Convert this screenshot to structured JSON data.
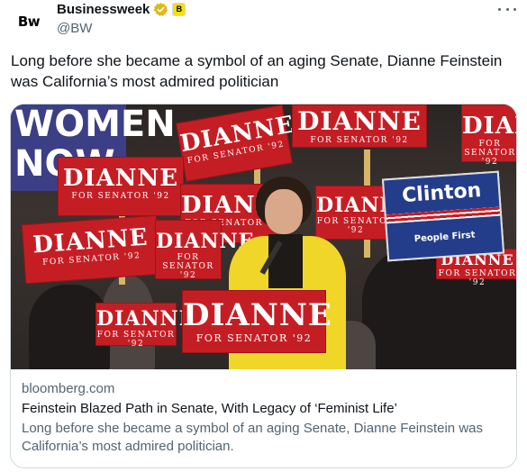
{
  "author": {
    "avatar_text": "Bw",
    "display_name": "Businessweek",
    "handle": "@BW",
    "affiliate_badge_text": "B"
  },
  "tweet": {
    "text": "Long before she became a symbol of an aging Senate, Dianne Feinstein was California’s most admired politician"
  },
  "card": {
    "domain": "bloomberg.com",
    "title": "Feinstein Blazed Path in Senate, With Legacy of ‘Feminist Life’",
    "description": "Long before she became a symbol of an aging Senate, Dianne Feinstein was California’s most admired politician.",
    "image": {
      "sign_main": "DIANNE",
      "sign_sub": "FOR SENATOR '92",
      "women_sign_line1": "WOMEN",
      "women_sign_line2": "NOW",
      "clinton_name": "Clinton",
      "clinton_slogan": "People First"
    }
  },
  "colors": {
    "sign_red": "#c41e24",
    "text_primary": "#0f1419",
    "text_secondary": "#536471",
    "verified_gold": "#e2b719",
    "card_border": "#cfd9de"
  },
  "icons": {
    "verified": "gold-verified-badge-icon",
    "affiliate": "affiliate-badge-icon",
    "more": "more-options-icon"
  }
}
